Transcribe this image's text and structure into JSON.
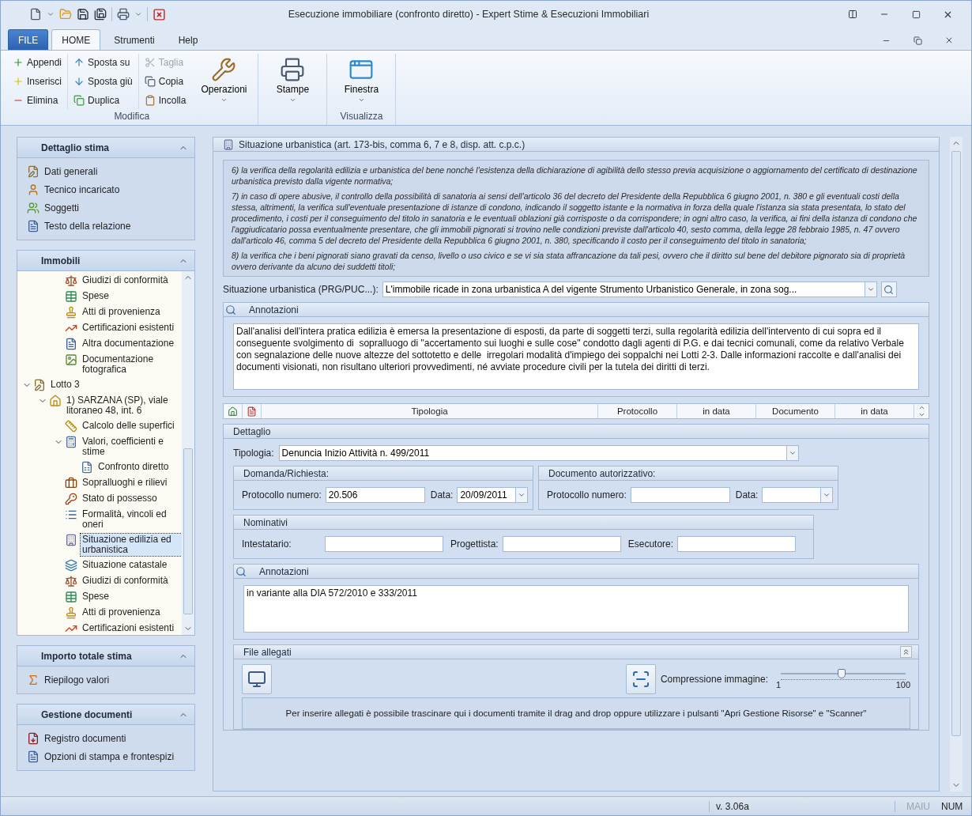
{
  "window": {
    "title": "Esecuzione immobiliare (confronto diretto) - Expert Stime & Esecuzioni Immobiliari"
  },
  "ribbon": {
    "tabs": [
      {
        "label": "FILE",
        "kind": "file",
        "selected": false
      },
      {
        "label": "HOME",
        "kind": "tab",
        "selected": true
      },
      {
        "label": "Strumenti",
        "kind": "tab",
        "selected": false
      },
      {
        "label": "Help",
        "kind": "tab",
        "selected": false
      }
    ],
    "groups": [
      {
        "label": "Modifica",
        "columns": [
          [
            {
              "label": "Appendi",
              "kind": "append",
              "disabled": false
            },
            {
              "label": "Inserisci",
              "kind": "insert",
              "disabled": false
            },
            {
              "label": "Elimina",
              "kind": "delete",
              "disabled": false
            }
          ],
          [
            {
              "label": "Sposta su",
              "kind": "up",
              "disabled": false
            },
            {
              "label": "Sposta giù",
              "kind": "down",
              "disabled": false
            },
            {
              "label": "Duplica",
              "kind": "duplicate",
              "disabled": false
            }
          ],
          [
            {
              "label": "Taglia",
              "kind": "cut",
              "disabled": true
            },
            {
              "label": "Copia",
              "kind": "copy",
              "disabled": false
            },
            {
              "label": "Incolla",
              "kind": "paste",
              "disabled": false
            }
          ]
        ],
        "large": [
          {
            "label": "Operazioni",
            "kind": "tools"
          }
        ]
      },
      {
        "large": [
          {
            "label": "Stampe",
            "kind": "printer"
          }
        ]
      },
      {
        "label": "Visualizza",
        "large": [
          {
            "label": "Finestra",
            "kind": "window"
          }
        ]
      }
    ]
  },
  "sidebar": {
    "panels": [
      {
        "title": "Dettaglio stima",
        "expanded": true,
        "items": [
          {
            "label": "Dati generali",
            "kind": "edit"
          },
          {
            "label": "Tecnico incaricato",
            "kind": "person"
          },
          {
            "label": "Soggetti",
            "kind": "people"
          },
          {
            "label": "Testo della relazione",
            "kind": "text"
          }
        ]
      },
      {
        "title": "Immobili",
        "expanded": true,
        "tree": {
          "continued": [
            {
              "label": "Giudizi di conformità",
              "kind": "scales",
              "selected": false
            },
            {
              "label": "Spese",
              "kind": "table",
              "selected": false
            },
            {
              "label": "Atti di provenienza",
              "kind": "stamp",
              "selected": false
            },
            {
              "label": "Certificazioni esistenti",
              "kind": "chart",
              "selected": false
            },
            {
              "label": "Altra documentazione",
              "kind": "text",
              "selected": false
            },
            {
              "label": "Documentazione fotografica",
              "kind": "photo",
              "selected": false
            }
          ],
          "nodes": [
            {
              "label": "Lotto 3",
              "kind": "edit",
              "selected": false,
              "expanded": true,
              "children": [
                {
                  "label": "1) SARZANA (SP), viale litoraneo 48, int. 6",
                  "kind": "home",
                  "selected": false,
                  "expanded": true,
                  "children": [
                    {
                      "label": "Calcolo delle superfici",
                      "kind": "ruler",
                      "selected": false
                    },
                    {
                      "label": "Valori, coefficienti e stime",
                      "kind": "calc",
                      "selected": false,
                      "expanded": true,
                      "children": [
                        {
                          "label": "Confronto diretto",
                          "kind": "sheet",
                          "selected": false
                        }
                      ]
                    },
                    {
                      "label": "Sopralluoghi e rilievi",
                      "kind": "case",
                      "selected": false
                    },
                    {
                      "label": "Stato di possesso",
                      "kind": "owner",
                      "selected": false
                    },
                    {
                      "label": "Formalità, vincoli ed oneri",
                      "kind": "list",
                      "selected": false
                    },
                    {
                      "label": "Situazione edilizia ed urbanistica",
                      "kind": "building",
                      "selected": true
                    },
                    {
                      "label": "Situazione catastale",
                      "kind": "map",
                      "selected": false
                    },
                    {
                      "label": "Giudizi di conformità",
                      "kind": "scales",
                      "selected": false
                    },
                    {
                      "label": "Spese",
                      "kind": "table",
                      "selected": false
                    },
                    {
                      "label": "Atti di provenienza",
                      "kind": "stamp",
                      "selected": false
                    },
                    {
                      "label": "Certificazioni esistenti",
                      "kind": "chart",
                      "selected": false
                    }
                  ]
                }
              ]
            }
          ]
        }
      },
      {
        "title": "Importo totale stima",
        "expanded": true,
        "items": [
          {
            "label": "Riepilogo valori",
            "kind": "sigma"
          }
        ]
      },
      {
        "title": "Gestione documenti",
        "expanded": true,
        "items": [
          {
            "label": "Registro documenti",
            "kind": "register"
          },
          {
            "label": "Opzioni di stampa e frontespizi",
            "kind": "text"
          }
        ]
      }
    ]
  },
  "content": {
    "title": "Situazione urbanistica (art. 173-bis, comma 6, 7 e 8, disp. att. c.p.c.)",
    "legal_text": [
      "6) la verifica della regolarità edilizia e urbanistica del bene nonché l'esistenza della dichiarazione di agibilità dello stesso previa acquisizione o aggiornamento del certificato di destinazione urbanistica previsto dalla vigente normativa;",
      "7) in caso di opere abusive, il controllo della possibilità di sanatoria ai sensi dell'articolo 36 del decreto del Presidente della Repubblica 6 giugno 2001, n. 380 e gli eventuali costi della stessa, altrimenti, la verifica sull'eventuale presentazione di istanze di condono, indicando il soggetto istante e la normativa in forza della quale l'istanza sia stata presentata, lo stato del procedimento, i costi per il conseguimento del titolo in sanatoria e le eventuali oblazioni già corrisposte o da corrispondere; in ogni altro caso, la verifica, ai fini della istanza di condono che l'aggiudicatario possa eventualmente presentare, che gli immobili pignorati si trovino nelle condizioni previste dall'articolo 40, sesto comma, della legge 28 febbraio 1985, n. 47 ovvero dall'articolo 46, comma 5 del decreto del Presidente della Repubblica 6 giugno 2001, n. 380, specificando il costo per il conseguimento del titolo in sanatoria;",
      "8) la verifica che i beni pignorati siano gravati da censo, livello o uso civico e se vi sia stata affrancazione da tali pesi, ovvero che il diritto sul bene del debitore pignorato sia di proprietà ovvero derivante da alcuno dei suddetti titoli;"
    ],
    "urban_situation": {
      "label": "Situazione urbanistica (PRG/PUC...):",
      "value": "L'immobile ricade in zona urbanistica A del vigente Strumento Urbanistico Generale, in zona sog..."
    },
    "notes": {
      "title": "Annotazioni",
      "text": "Dall'analisi dell'intera pratica edilizia è emersa la presentazione di esposti, da parte di soggetti terzi, sulla regolarità edilizia dell'intervento di cui sopra ed il conseguente svolgimento di  sopralluogo di \"accertamento sui luoghi e sulle cose\" condotto dagli agenti di P.G. e dai tecnici comunali, come da relativo Verbale con segnalazione delle nuove altezze del sottotetto e delle  irregolari modalità d'impiego dei soppalchi nei Lotti 2-3. Dalle informazioni raccolte e dall'analisi dei documenti visionati, non risultano ulteriori provvedimenti, né avviate procedure civili per la tutela dei diritti di terzi."
    },
    "grid": {
      "columns": [
        "Tipologia",
        "Protocollo",
        "in data",
        "Documento",
        "in data"
      ]
    },
    "detail": {
      "title": "Dettaglio",
      "type": {
        "label": "Tipologia:",
        "value": "Denuncia Inizio Attività n. 499/2011"
      },
      "request": {
        "title": "Domanda/Richiesta:",
        "protocol_label": "Protocollo numero:",
        "protocol": "20.506",
        "date_label": "Data:",
        "date": "20/09/2011"
      },
      "authorization": {
        "title": "Documento autorizzativo:",
        "protocol_label": "Protocollo numero:",
        "date_label": "Data:"
      },
      "names": {
        "title": "Nominativi",
        "fields": [
          {
            "label": "Intestatario:"
          },
          {
            "label": "Progettista:"
          },
          {
            "label": "Esecutore:"
          }
        ]
      },
      "notes": {
        "title": "Annotazioni",
        "text": "in variante alla DIA 572/2010 e 333/2011"
      },
      "attachments": {
        "title": "File allegati",
        "compression": {
          "label": "Compressione immagine:",
          "level": 0.49,
          "min": "1",
          "max": "100"
        },
        "drop_hint": "Per inserire allegati è possibile trascinare qui i documenti tramite il drag and drop oppure utilizzare i pulsanti \"Apri Gestione Risorse\" e \"Scanner\""
      }
    }
  },
  "status_bar": {
    "version": "v. 3.06a",
    "indicators": [
      {
        "label": "MAIU",
        "on": false
      },
      {
        "label": "NUM",
        "on": true
      }
    ]
  }
}
